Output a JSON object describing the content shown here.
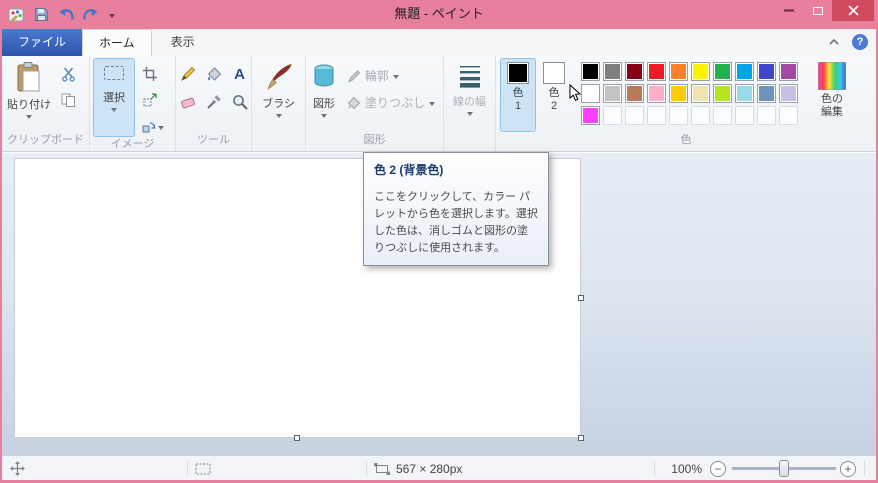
{
  "window": {
    "title": "無題 - ペイント"
  },
  "tabs": {
    "file": "ファイル",
    "home": "ホーム",
    "view": "表示"
  },
  "glyphs": {
    "help": "?",
    "text_tool": "A",
    "zoom_out": "−",
    "zoom_in": "+"
  },
  "ribbon": {
    "clipboard": {
      "group_label": "クリップボード",
      "paste_label": "貼り付け"
    },
    "image": {
      "group_label": "イメージ",
      "select_label": "選択"
    },
    "tools": {
      "group_label": "ツール"
    },
    "brushes": {
      "button_label": "ブラシ"
    },
    "shapes": {
      "group_label": "図形",
      "button_label": "図形",
      "outline_label": "輪郭",
      "fill_label": "塗りつぶし"
    },
    "size": {
      "button_label": "線の幅"
    },
    "colors": {
      "group_label": "色",
      "color1": {
        "value": "#000000",
        "label_line1": "色",
        "label_line2": "1"
      },
      "color2": {
        "value": "#ffffff",
        "label_line1": "色",
        "label_line2": "2"
      },
      "edit_label_line1": "色の",
      "edit_label_line2": "編集",
      "palette": [
        [
          "#000000",
          "#7f7f7f",
          "#880015",
          "#ed1c24",
          "#ff7f27",
          "#fff200",
          "#22b14c",
          "#00a2e8",
          "#3f48cc",
          "#a349a4"
        ],
        [
          "#ffffff",
          "#c3c3c3",
          "#b97a57",
          "#ffaec9",
          "#ffc90e",
          "#efe4b0",
          "#b5e61d",
          "#99d9ea",
          "#7092be",
          "#c8bfe7"
        ],
        [
          "#ff40ff",
          "",
          "",
          "",
          "",
          "",
          "",
          "",
          "",
          ""
        ]
      ]
    }
  },
  "tooltip": {
    "title": "色 2 (背景色)",
    "body": "ここをクリックして、カラー パレットから色を選択します。選択した色は、消しゴムと図形の塗りつぶしに使用されます。"
  },
  "statusbar": {
    "canvas_size": "567 × 280px",
    "zoom_level": "100%"
  },
  "theme": {
    "titlebar_pink": "#e87f9d",
    "close_red": "#cf4b5d",
    "file_tab_blue": "#2f5cb5"
  }
}
